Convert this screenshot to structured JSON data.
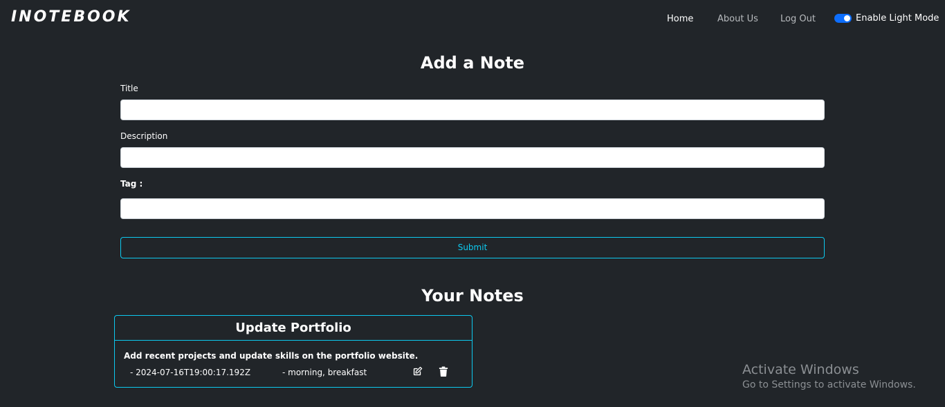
{
  "navbar": {
    "brand": "iNotebook",
    "links": [
      {
        "label": "Home",
        "active": true
      },
      {
        "label": "About Us",
        "active": false
      },
      {
        "label": "Log Out",
        "active": false
      }
    ],
    "mode_toggle": {
      "label": "Enable Light Mode",
      "checked": true,
      "color": "#0d6efd"
    }
  },
  "add_note": {
    "heading": "Add a Note",
    "title_label": "Title",
    "title_value": "",
    "description_label": "Description",
    "description_value": "",
    "tag_label": "Tag :",
    "tag_value": "",
    "submit_label": "Submit"
  },
  "notes_section": {
    "heading": "Your Notes",
    "notes": [
      {
        "title": "Update Portfolio",
        "description": "Add recent projects and update skills on the portfolio website.",
        "date": "- 2024-07-16T19:00:17.192Z",
        "tags": "- morning, breakfast",
        "edit_icon": "edit-icon",
        "delete_icon": "trash-icon"
      }
    ]
  },
  "watermark": {
    "title": "Activate Windows",
    "subtitle": "Go to Settings to activate Windows."
  },
  "colors": {
    "background": "#212529",
    "accent": "#0dcaf0",
    "toggle": "#0d6efd"
  }
}
